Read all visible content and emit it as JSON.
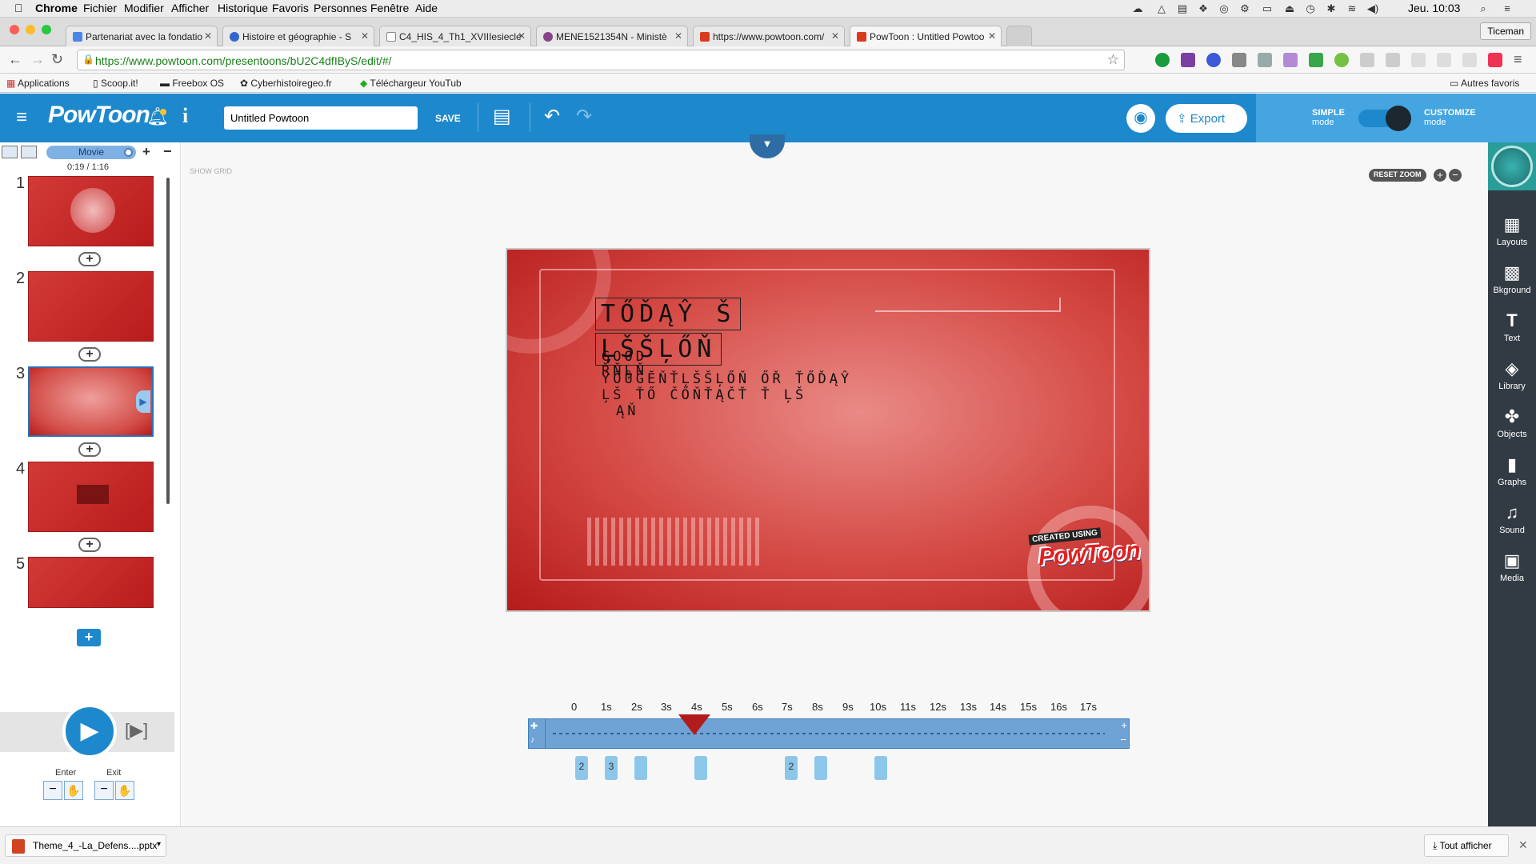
{
  "menubar": {
    "app": "Chrome",
    "items": [
      "Fichier",
      "Modifier",
      "Afficher",
      "Historique",
      "Favoris",
      "Personnes",
      "Fenêtre",
      "Aide"
    ],
    "clock": "Jeu. 10:03"
  },
  "tabs": [
    {
      "label": "Partenariat avec la fondatio",
      "color": "#4a86e8"
    },
    {
      "label": "Histoire et géographie - S",
      "color": "#3366cc"
    },
    {
      "label": "C4_HIS_4_Th1_XVIIIesiecle",
      "color": "#ffffff"
    },
    {
      "label": "MENE1521354N - Ministè",
      "color": "#884488"
    },
    {
      "label": "https://www.powtoon.com/",
      "color": "#d93b1f"
    },
    {
      "label": "PowToon : Untitled Powtoo",
      "color": "#d93b1f"
    }
  ],
  "profile": "Ticeman",
  "address": {
    "url": "https://www.powtoon.com/presentoons/bU2C4dfIByS/edit/#/"
  },
  "bookmarks": [
    "Applications",
    "Scoop.it!",
    "Freebox OS",
    "Cyberhistoiregeo.fr",
    "Téléchargeur YouTub"
  ],
  "bookmarks_other": "Autres favoris",
  "toolbar": {
    "logo": "PowToon",
    "title_value": "Untitled Powtoon",
    "save_label": "SAVE",
    "export_label": "Export",
    "simple_mode": "SIMPLE",
    "simple_mode_sub": "mode",
    "customize_mode": "CUSTOMIZE",
    "customize_mode_sub": "mode"
  },
  "leftpanel": {
    "view_label": "Movie",
    "time": "0:19 / 1:16",
    "slides": [
      "1",
      "2",
      "3",
      "4",
      "5"
    ],
    "enter_label": "Enter",
    "exit_label": "Exit"
  },
  "stage": {
    "show_grid": "SHOW GRID",
    "reset_zoom": "RESET ZOOM"
  },
  "slide": {
    "title_line1": "TŐĎĄŶ Š",
    "title_line2": "ĻŠŠĻŐŇ",
    "body_line1": "GOOD",
    "body_line2": "ŘŇĻŇ",
    "body_line3": "ÝŐŮĞĔŇŤĻŠŠĻŐŇ ŐŘ ŤŐĎĄŶ",
    "body_line4": "ĻŠ ŤŐ ČŐŇŤĄČŤ Ť ĻŠ",
    "body_line5": "ĄŇ",
    "watermark_top": "CREATED USING",
    "watermark_logo": "PowToon"
  },
  "rightbar": {
    "tools": [
      "Layouts",
      "Bkground",
      "Text",
      "Library",
      "Objects",
      "Graphs",
      "Sound",
      "Media"
    ]
  },
  "timeline": {
    "ticks": [
      "0",
      "1s",
      "2s",
      "3s",
      "4s",
      "5s",
      "6s",
      "7s",
      "8s",
      "9s",
      "10s",
      "11s",
      "12s",
      "13s",
      "14s",
      "15s",
      "16s",
      "17s"
    ],
    "markers": [
      "2",
      "3",
      "",
      "",
      "2",
      "",
      ""
    ]
  },
  "download": {
    "file": "Theme_4_-La_Defens....pptx",
    "show_all": "Tout afficher"
  },
  "colors": {
    "toolbar": "#1e88cc",
    "slide_red": "#d44843",
    "sidebar": "#323b44"
  }
}
